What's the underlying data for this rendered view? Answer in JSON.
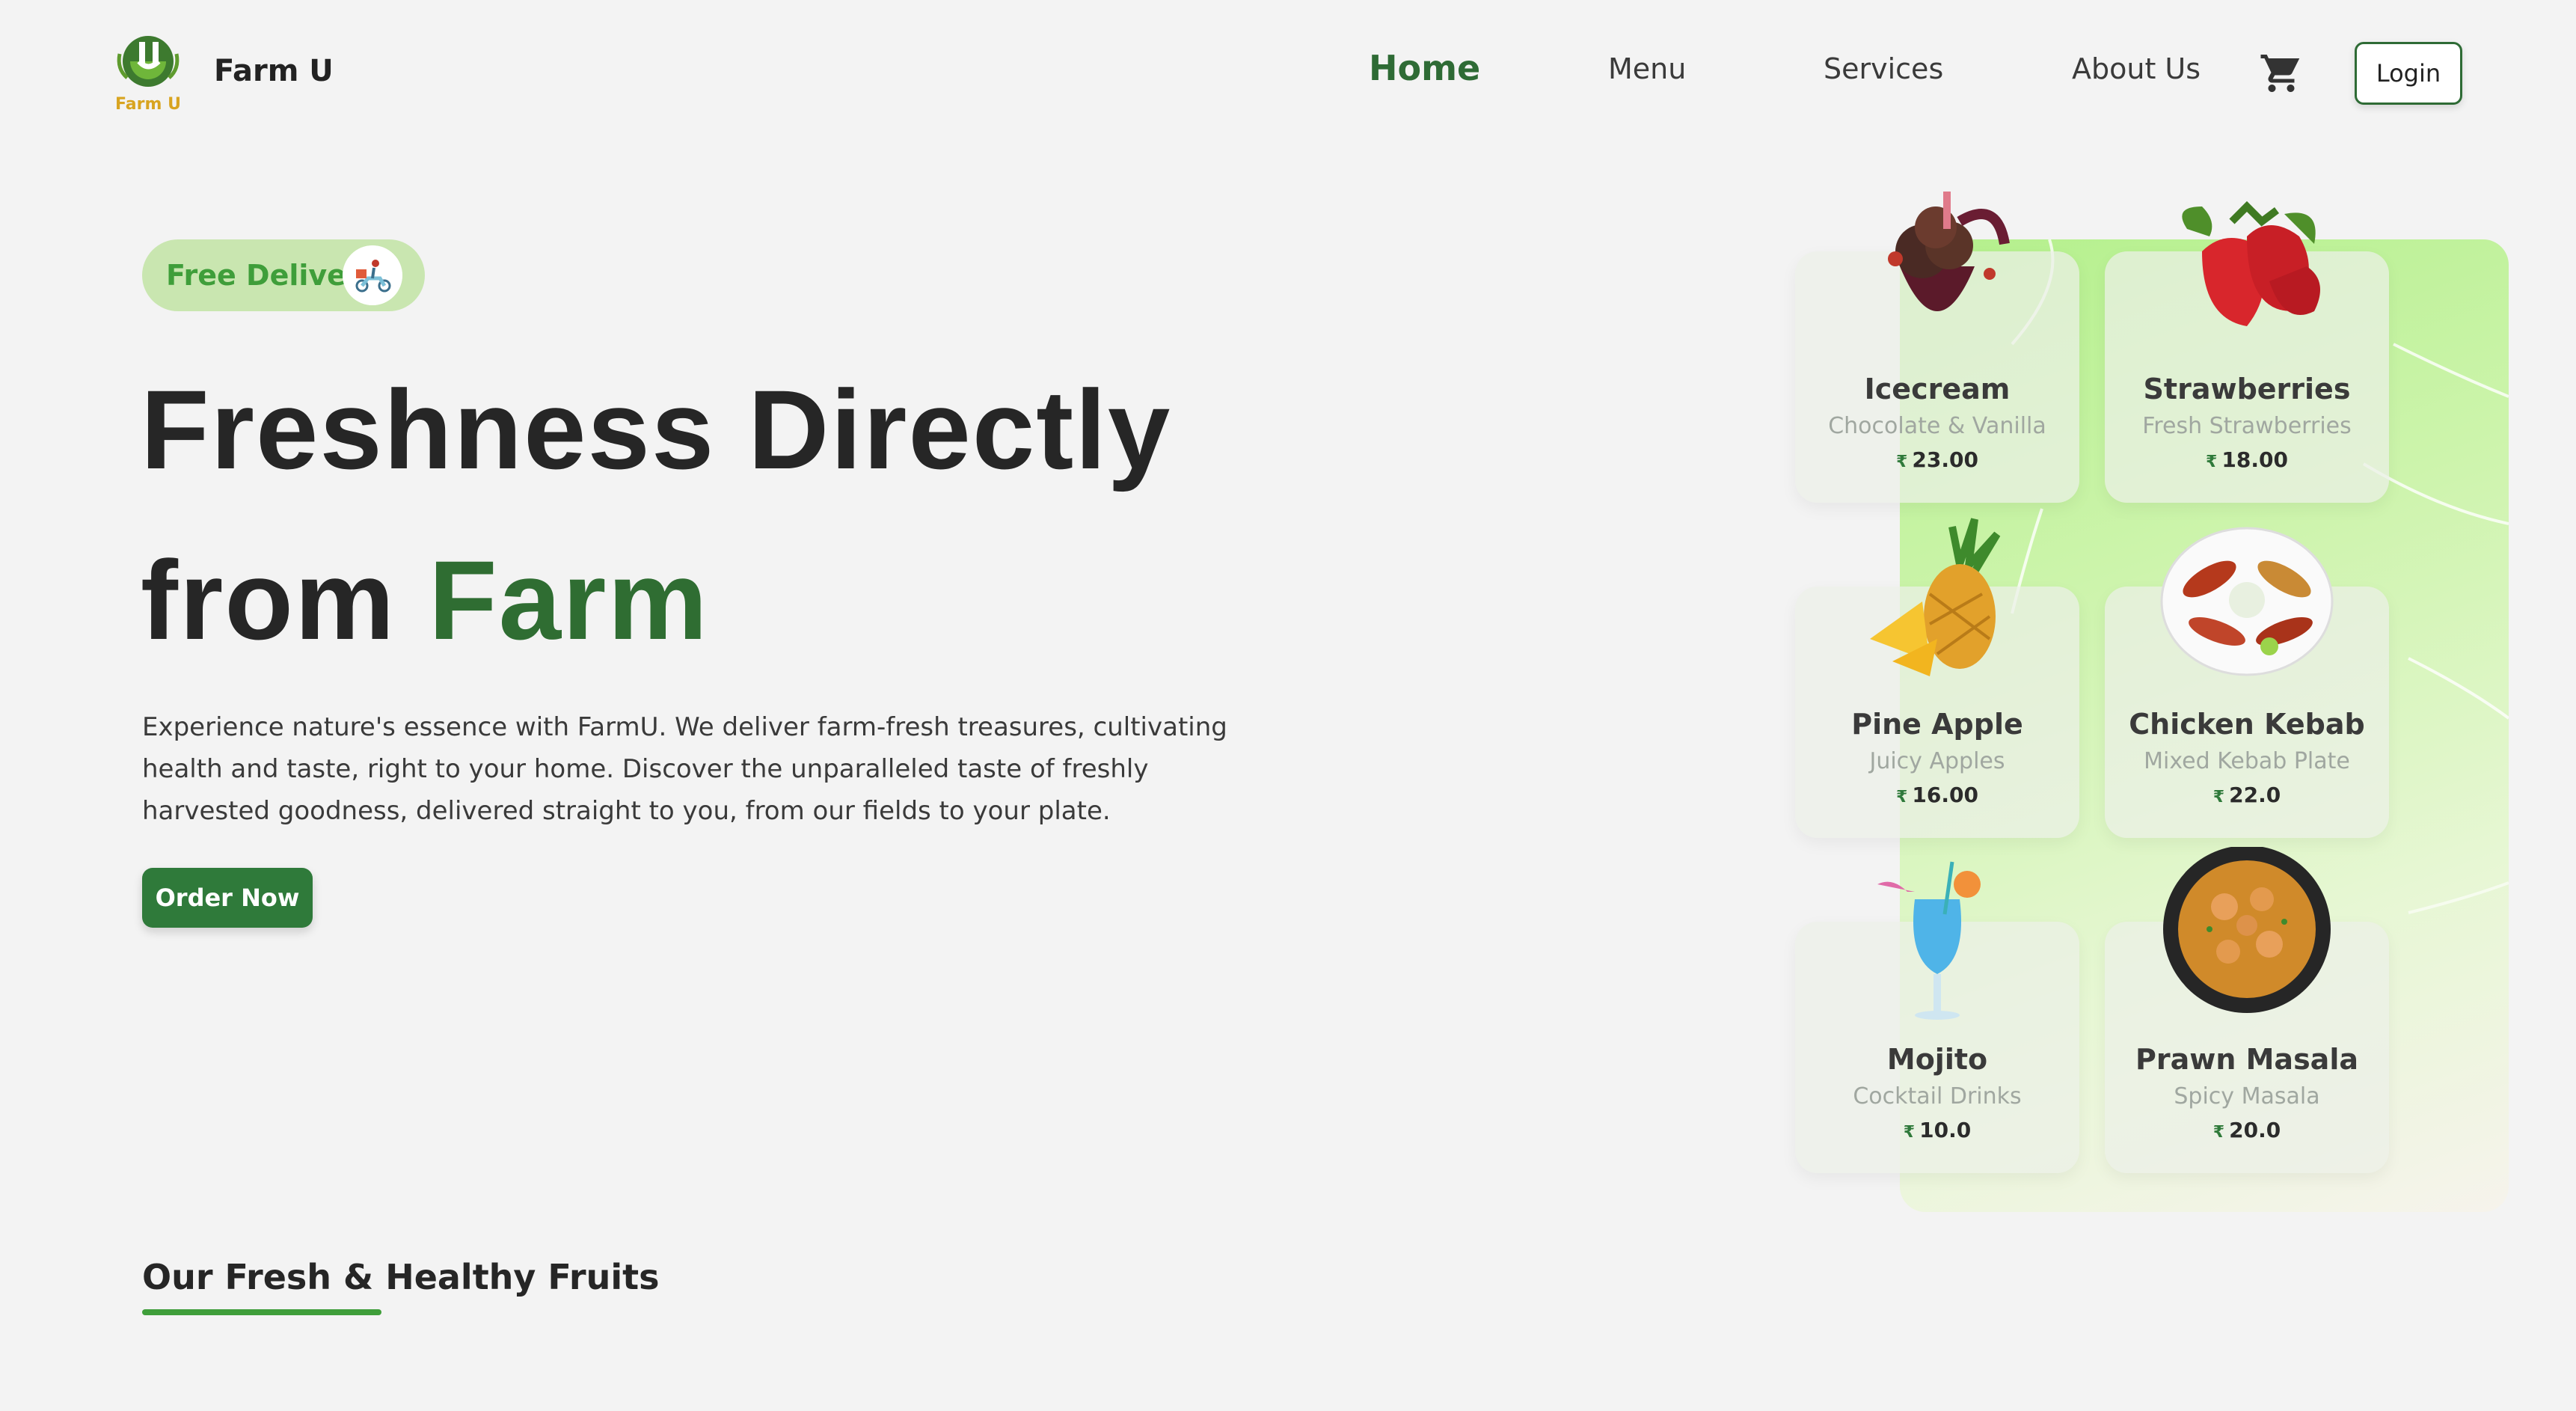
{
  "header": {
    "logo_text": "Farm U",
    "brand": "Farm U",
    "nav": [
      {
        "label": "Home",
        "active": true
      },
      {
        "label": "Menu",
        "active": false
      },
      {
        "label": "Services",
        "active": false
      },
      {
        "label": "About Us",
        "active": false
      }
    ],
    "cart_icon": "cart-icon",
    "login_label": "Login"
  },
  "hero": {
    "badge_label": "Free Delivery",
    "badge_icon": "scooter-icon",
    "title_line1": "Freshness Directly",
    "title_line2_prefix": "from ",
    "title_line2_highlight": "Farm",
    "description": "Experience nature's essence with FarmU. We deliver farm-fresh treasures, cultivating health and taste, right to your home. Discover the unparalleled taste of freshly harvested goodness, delivered straight to you, from our fields to your plate.",
    "cta_label": "Order Now"
  },
  "menu_cards": [
    {
      "name": "Icecream",
      "subtitle": "Chocolate & Vanilla",
      "currency": "₹",
      "price": "23.00",
      "image": "icecream-image"
    },
    {
      "name": "Strawberries",
      "subtitle": "Fresh Strawberries",
      "currency": "₹",
      "price": "18.00",
      "image": "strawberry-image"
    },
    {
      "name": "Pine Apple",
      "subtitle": "Juicy Apples",
      "currency": "₹",
      "price": "16.00",
      "image": "pineapple-image"
    },
    {
      "name": "Chicken Kebab",
      "subtitle": "Mixed Kebab Plate",
      "currency": "₹",
      "price": "22.0",
      "image": "kebab-image"
    },
    {
      "name": "Mojito",
      "subtitle": "Cocktail Drinks",
      "currency": "₹",
      "price": "10.0",
      "image": "mojito-image"
    },
    {
      "name": "Prawn Masala",
      "subtitle": "Spicy Masala",
      "currency": "₹",
      "price": "20.0",
      "image": "prawn-masala-image"
    }
  ],
  "section": {
    "title": "Our Fresh & Healthy Fruits"
  },
  "colors": {
    "brand_green": "#2f6d32",
    "accent_green": "#3f9e3a",
    "background": "#f3f3f3"
  }
}
